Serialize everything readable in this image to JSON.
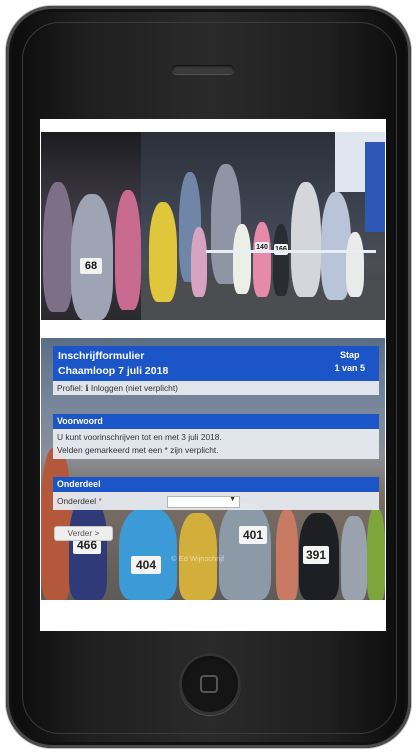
{
  "form": {
    "title_line1": "Inschrijfformulier",
    "title_line2": "Chaamloop 7 juli 2018",
    "step_label": "Stap",
    "step_value": "1 van 5",
    "profile_text": "Profiel: ℹ Inloggen (niet verplicht)",
    "voorwoord_title": "Voorwoord",
    "voorwoord_line1": "U kunt voorinschrijven tot en met 3 juli 2018.",
    "voorwoord_line2": "Velden gemarkeerd met een * zijn verplicht.",
    "onderdeel_title": "Onderdeel",
    "onderdeel_label": "Onderdeel",
    "required_marker": "*",
    "select_value": "",
    "next_button": "Verder >"
  },
  "photo_top": {
    "bibs": [
      "68",
      "140",
      "166"
    ]
  },
  "photo_bottom": {
    "bibs": [
      "466",
      "404",
      "401",
      "391"
    ],
    "watermark": "© Ed Wijnschrijf"
  },
  "colors": {
    "accent_blue": "#1c55c8",
    "phone_body": "#1f1f1f"
  },
  "icons": {
    "select_arrow": "chevron-down-icon"
  }
}
